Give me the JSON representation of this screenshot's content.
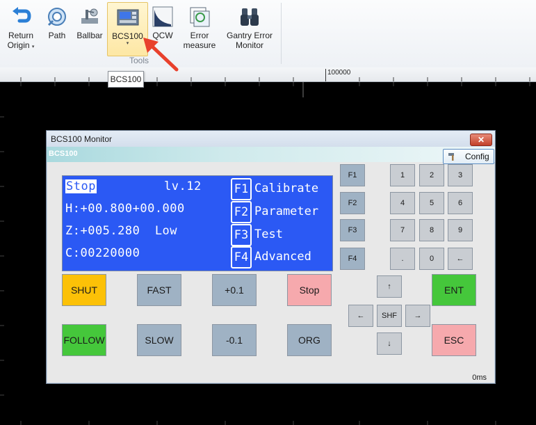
{
  "ribbon": {
    "buttons": [
      {
        "label1": "Return",
        "label2": "Origin",
        "has_caret": true,
        "icon": "return-arrow-icon"
      },
      {
        "label1": "Path",
        "label2": "",
        "icon": "path-icon"
      },
      {
        "label1": "Ballbar",
        "label2": "",
        "icon": "ballbar-icon"
      },
      {
        "label1": "BCS100",
        "label2": "",
        "has_caret": true,
        "icon": "bcs100-icon",
        "active": true
      },
      {
        "label1": "QCW",
        "label2": "",
        "icon": "qcw-icon"
      },
      {
        "label1": "Error",
        "label2": "measure",
        "icon": "error-measure-icon"
      },
      {
        "label1": "Gantry Error",
        "label2": "Monitor",
        "icon": "binoculars-icon"
      }
    ],
    "group_label": "Tools",
    "caret": "▾"
  },
  "tooltip": "BCS100",
  "ruler": {
    "label": "100000"
  },
  "dialog": {
    "title": "BCS100 Monitor",
    "close_glyph": "✕",
    "subtitle": "BCS100",
    "config_label": "Config",
    "lcd": {
      "status": "Stop",
      "level": "lv.12",
      "line_h": "H:+00.800+00.000",
      "line_z": "Z:+005.280  Low",
      "line_c": "C:00220000",
      "fkeys": [
        {
          "key": "F1",
          "label": "Calibrate"
        },
        {
          "key": "F2",
          "label": "Parameter"
        },
        {
          "key": "F3",
          "label": "Test"
        },
        {
          "key": "F4",
          "label": "Advanced"
        }
      ]
    },
    "side_fkeys": [
      "F1",
      "F2",
      "F3",
      "F4"
    ],
    "keypad": [
      "1",
      "2",
      "3",
      "4",
      "5",
      "6",
      "7",
      "8",
      "9",
      ".",
      "0",
      "←"
    ],
    "controls": {
      "shut": "SHUT",
      "fast": "FAST",
      "plus": "+0.1",
      "stop": "Stop",
      "follow": "FOLLOW",
      "slow": "SLOW",
      "minus": "-0.1",
      "org": "ORG",
      "ent": "ENT",
      "esc": "ESC",
      "shf": "SHF",
      "up": "↑",
      "down": "↓",
      "left": "←",
      "right": "→"
    },
    "status_text": "0ms"
  },
  "colors": {
    "lcd_blue": "#2b59f4",
    "shut": "#fcc107",
    "follow": "#45c73b",
    "stop": "#f6a9ad",
    "annotation_arrow": "#e8412c"
  }
}
